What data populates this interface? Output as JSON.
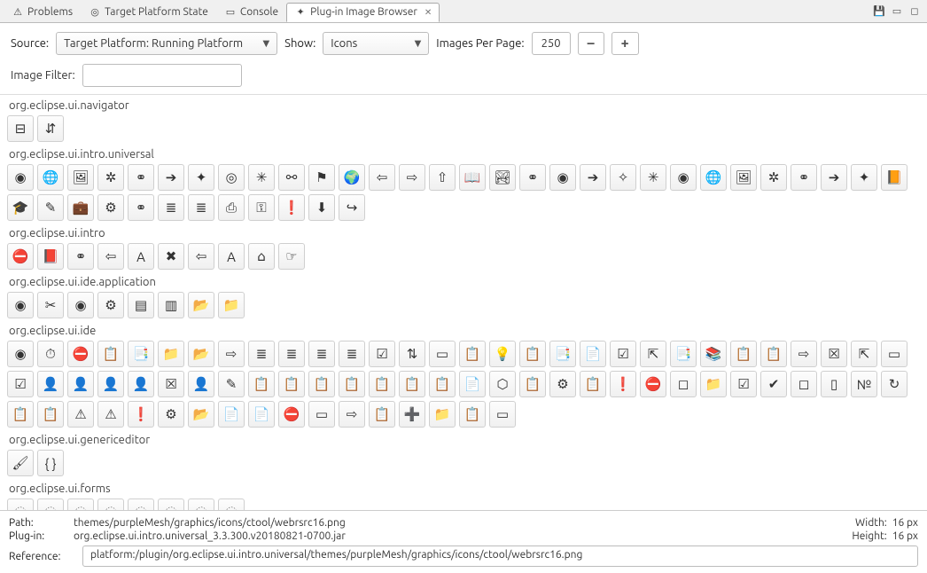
{
  "tabs": [
    {
      "label": "Problems",
      "icon": "⚠"
    },
    {
      "label": "Target Platform State",
      "icon": "◎"
    },
    {
      "label": "Console",
      "icon": "▭"
    },
    {
      "label": "Plug-in Image Browser",
      "icon": "✦",
      "active": true
    }
  ],
  "tabsRightIcons": [
    "save-icon",
    "minimize-icon",
    "maximize-icon"
  ],
  "toolbar": {
    "source_label": "Source:",
    "source_value": "Target Platform: Running Platform",
    "show_label": "Show:",
    "show_value": "Icons",
    "ipp_label": "Images Per Page:",
    "ipp_value": "250",
    "minus": "–",
    "plus": "+"
  },
  "filter": {
    "label": "Image Filter:",
    "value": ""
  },
  "sections": [
    {
      "title": "org.eclipse.ui.navigator",
      "count": 2,
      "iconset": [
        "collapse",
        "link"
      ]
    },
    {
      "title": "org.eclipse.ui.intro.universal",
      "count": 42,
      "iconset": [
        "compass",
        "globe",
        "image",
        "wheel",
        "orbs",
        "arrowR",
        "star",
        "compassO",
        "wheelB",
        "orbsR",
        "flag",
        "globe2",
        "arrowY",
        "arrowG",
        "arrowYo",
        "book",
        "image2",
        "orbsG",
        "compass2",
        "arrowGr",
        "star2",
        "wheelB2",
        "compass3",
        "globe3",
        "imageG",
        "wheelG",
        "orbsY",
        "arrowGr2",
        "star3",
        "book2",
        "grad",
        "pencil",
        "case",
        "gear",
        "orbsB",
        "listY",
        "listB",
        "print",
        "key",
        "excl",
        "arrowD",
        "arrowCurve"
      ]
    },
    {
      "title": "org.eclipse.ui.intro",
      "count": 10,
      "iconset": [
        "closeR",
        "bookR",
        "orbs",
        "arrowY",
        "Af",
        "x",
        "arrowY2",
        "Af2",
        "home",
        "hand"
      ]
    },
    {
      "title": "org.eclipse.ui.ide.application",
      "count": 8,
      "iconset": [
        "compass",
        "tools",
        "compassG",
        "gearP",
        "listColor",
        "listColor2",
        "folderO",
        "folderY"
      ]
    },
    {
      "title": "org.eclipse.ui.ide",
      "count": 77,
      "iconset": "auto"
    },
    {
      "title": "org.eclipse.ui.genericeditor",
      "count": 2,
      "iconset": [
        "brush",
        "braces"
      ]
    },
    {
      "title": "org.eclipse.ui.forms",
      "count": 8,
      "iconset": [
        "spin",
        "spin",
        "spin",
        "spin",
        "spin",
        "spin",
        "spin",
        "spin"
      ]
    }
  ],
  "footer": {
    "path_label": "Path:",
    "path_value": "themes/purpleMesh/graphics/icons/ctool/webrsrc16.png",
    "plugin_label": "Plug-in:",
    "plugin_value": "org.eclipse.ui.intro.universal_3.3.300.v20180821-0700.jar",
    "width_label": "Width:",
    "width_value": "16 px",
    "height_label": "Height:",
    "height_value": "16 px",
    "ref_label": "Reference:",
    "ref_value": "platform:/plugin/org.eclipse.ui.intro.universal/themes/purpleMesh/graphics/icons/ctool/webrsrc16.png"
  },
  "glyphs": {
    "collapse": "⊟",
    "link": "⇵",
    "compass": "◉",
    "globe": "🌐",
    "image": "🖼",
    "wheel": "✲",
    "orbs": "⚭",
    "arrowR": "➔",
    "star": "✦",
    "compassO": "◎",
    "wheelB": "✳",
    "orbsR": "⚯",
    "flag": "⚑",
    "globe2": "🌍",
    "arrowY": "⇦",
    "arrowG": "⇨",
    "arrowYo": "⇧",
    "book": "📖",
    "image2": "🏞",
    "orbsG": "⚭",
    "compass2": "◉",
    "arrowGr": "➔",
    "star2": "✧",
    "wheelB2": "✳",
    "compass3": "◉",
    "globe3": "🌐",
    "imageG": "🖼",
    "wheelG": "✲",
    "orbsY": "⚭",
    "arrowGr2": "➔",
    "star3": "✦",
    "book2": "📙",
    "grad": "🎓",
    "pencil": "✎",
    "case": "💼",
    "gear": "⚙",
    "orbsB": "⚭",
    "listY": "≣",
    "listB": "≣",
    "print": "⎙",
    "key": "⚿",
    "excl": "❗",
    "arrowD": "⬇",
    "arrowCurve": "↪",
    "closeR": "⛔",
    "bookR": "📕",
    "Af": "A",
    "x": "✖",
    "arrowY2": "⇦",
    "Af2": "A",
    "home": "⌂",
    "hand": "☞",
    "tools": "✂",
    "compassG": "◉",
    "gearP": "⚙",
    "listColor": "▤",
    "listColor2": "▥",
    "folderO": "📂",
    "folderY": "📁",
    "brush": "🖌",
    "braces": "{ }",
    "spin": "◌"
  },
  "ideIcons": [
    "◉",
    "⏱",
    "⛔",
    "📋",
    "📑",
    "📁",
    "📂",
    "⇨",
    "≣",
    "≣",
    "≣",
    "≣",
    "☑",
    "⇅",
    "▭",
    "📋",
    "💡",
    "📋",
    "📑",
    "📄",
    "☑",
    "⇱",
    "📑",
    "📚",
    "📋",
    "📋",
    "⇨",
    "☒",
    "⇱",
    "▭",
    "☑",
    "👤",
    "👤",
    "👤",
    "👤",
    "☒",
    "👤",
    "✎",
    "📋",
    "📋",
    "📋",
    "📋",
    "📋",
    "📋",
    "📋",
    "📄",
    "⬡",
    "📋",
    "⚙",
    "📋",
    "❗",
    "⛔",
    "◻",
    "📁",
    "☑",
    "✔",
    "◻",
    "▯",
    "№",
    "↻",
    "📋",
    "📋",
    "⚠",
    "⚠",
    "❗",
    "⚙",
    "📂",
    "📄",
    "📄",
    "⛔",
    "▭",
    "⇨",
    "📋",
    "➕",
    "📁",
    "📋",
    "▭"
  ]
}
